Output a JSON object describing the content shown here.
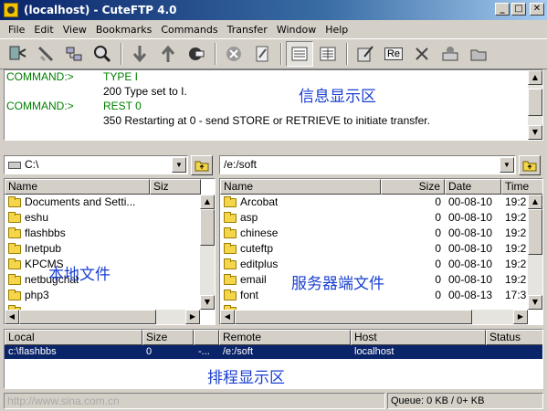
{
  "window": {
    "title": "(localhost) - CuteFTP 4.0",
    "min": "_",
    "max": "□",
    "close": "✕"
  },
  "menu": [
    "File",
    "Edit",
    "View",
    "Bookmarks",
    "Commands",
    "Transfer",
    "Window",
    "Help"
  ],
  "toolbar": {
    "buttons": [
      "connect-icon",
      "disconnect-icon",
      "site-manager-icon",
      "search-icon",
      "download-icon",
      "upload-icon",
      "quick-connect-icon",
      "stop-icon",
      "edit-icon",
      "list-view-icon",
      "details-view-icon",
      "properties-icon",
      "reconnect-icon",
      "delete-icon",
      "refresh-icon",
      "folder-icon"
    ],
    "reconnect_label": "Re"
  },
  "log": {
    "lines": [
      {
        "cmd": "COMMAND:>",
        "text": "TYPE I"
      },
      {
        "cmd": "",
        "text": "200 Type set to I."
      },
      {
        "cmd": "COMMAND:>",
        "text": "REST 0"
      },
      {
        "cmd": "",
        "text": "350 Restarting at 0 - send STORE or RETRIEVE to initiate transfer."
      }
    ],
    "overlay_label": "信息显示区"
  },
  "local": {
    "path": "C:\\",
    "columns": [
      "Name",
      "Siz"
    ],
    "files": [
      "Documents and Setti...",
      "eshu",
      "flashbbs",
      "Inetpub",
      "KPCMS",
      "netbugchat",
      "php3",
      "..."
    ],
    "overlay_label": "本地文件"
  },
  "remote": {
    "path": "/e:/soft",
    "columns": [
      "Name",
      "Size",
      "Date",
      "Time"
    ],
    "files": [
      {
        "name": "Arcobat",
        "size": "0",
        "date": "00-08-10",
        "time": "19:2"
      },
      {
        "name": "asp",
        "size": "0",
        "date": "00-08-10",
        "time": "19:2"
      },
      {
        "name": "chinese",
        "size": "0",
        "date": "00-08-10",
        "time": "19:2"
      },
      {
        "name": "cuteftp",
        "size": "0",
        "date": "00-08-10",
        "time": "19:2"
      },
      {
        "name": "editplus",
        "size": "0",
        "date": "00-08-10",
        "time": "19:2"
      },
      {
        "name": "email",
        "size": "0",
        "date": "00-08-10",
        "time": "19:2"
      },
      {
        "name": "font",
        "size": "0",
        "date": "00-08-13",
        "time": "17:3"
      },
      {
        "name": "...",
        "size": "",
        "date": "",
        "time": ""
      }
    ],
    "overlay_label": "服务器端文件"
  },
  "queue": {
    "columns": [
      "Local",
      "Size",
      "",
      "Remote",
      "Host",
      "Status"
    ],
    "row": {
      "local": "c:\\flashbbs",
      "size": "0",
      "progress": "-...",
      "remote": "/e:/soft",
      "host": "localhost",
      "status": ""
    },
    "overlay_label": "排程显示区"
  },
  "status": {
    "watermark": "http://www.sina.com.cn",
    "queue": "Queue: 0 KB / 0+ KB"
  }
}
